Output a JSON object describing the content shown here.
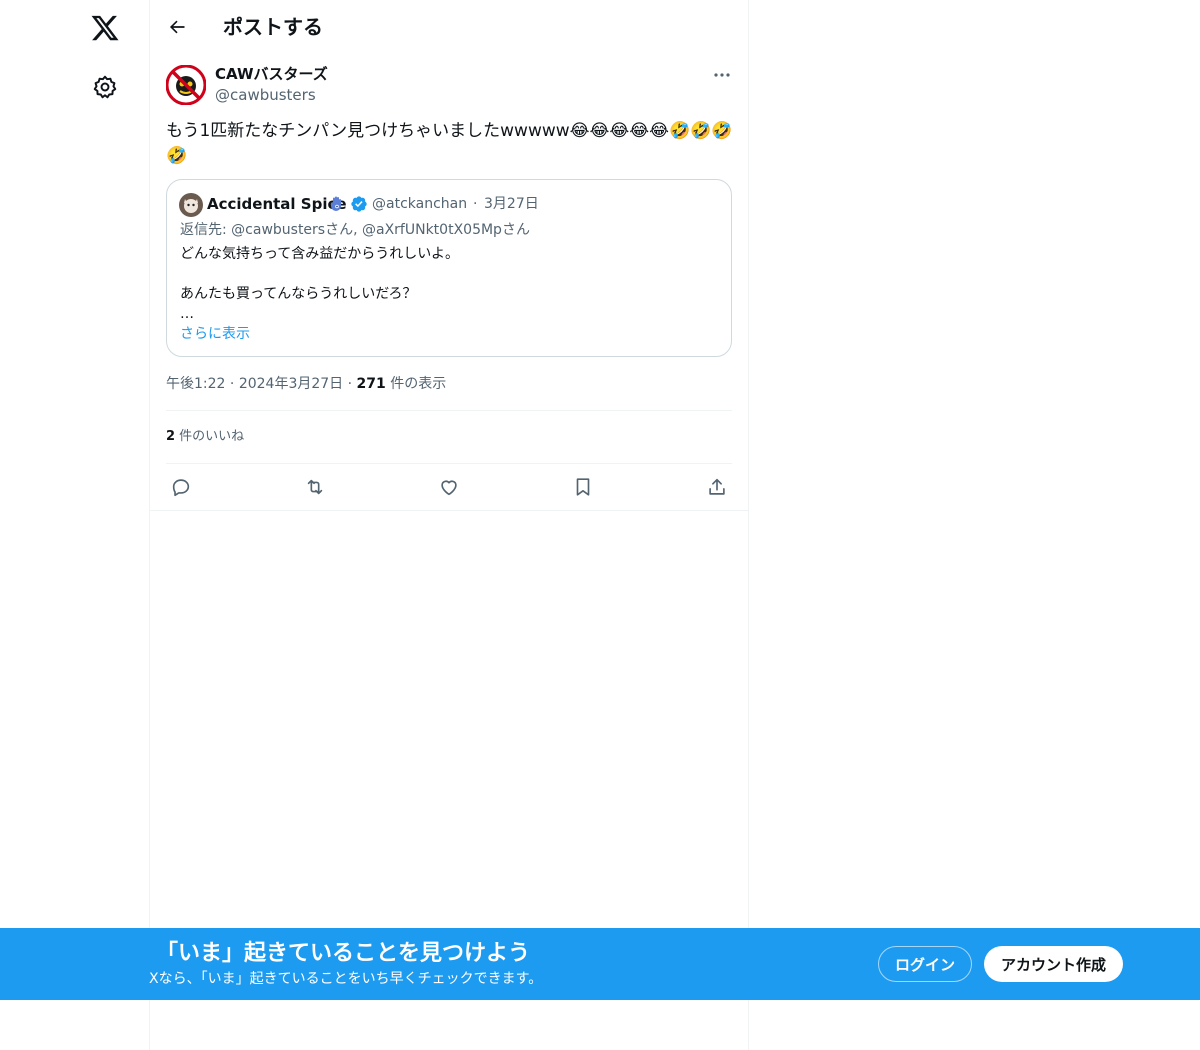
{
  "header": {
    "title": "ポストする"
  },
  "post": {
    "author_name": "CAWバスターズ",
    "author_handle": "@cawbusters",
    "text": "もう1匹新たなチンパン見つけちゃいましたwwwww😂😂😂😂😂🤣🤣🤣🤣",
    "quote": {
      "name": "Accidental Spice",
      "handle": "@atckanchan",
      "separator": "·",
      "date": "3月27日",
      "reply_to": "返信先: @cawbustersさん, @aXrfUNkt0tX05Mpさん",
      "line1": "どんな気持ちって含み益だからうれしいよ。",
      "line2": "あんたも買ってんならうれしいだろ？",
      "ellipsis": "…",
      "show_more": "さらに表示"
    },
    "time": "午後1:22",
    "meta_sep": "·",
    "date": "2024年3月27日",
    "views_count": "271",
    "views_label": " 件の表示",
    "likes_count": "2",
    "likes_label": " 件のいいね"
  },
  "banner": {
    "title": "「いま」起きていることを見つけよう",
    "subtitle": "Xなら、「いま」起きていることをいち早くチェックできます。",
    "login_label": "ログイン",
    "signup_label": "アカウント作成"
  },
  "colors": {
    "accent": "#1d9bf0",
    "text": "#0f1419",
    "secondary": "#536471",
    "border": "#cfd9de"
  },
  "icons": [
    "x-logo-icon",
    "settings-icon",
    "back-arrow-icon",
    "more-icon",
    "reply-icon",
    "repost-icon",
    "like-icon",
    "bookmark-icon",
    "share-icon",
    "verified-icon"
  ]
}
